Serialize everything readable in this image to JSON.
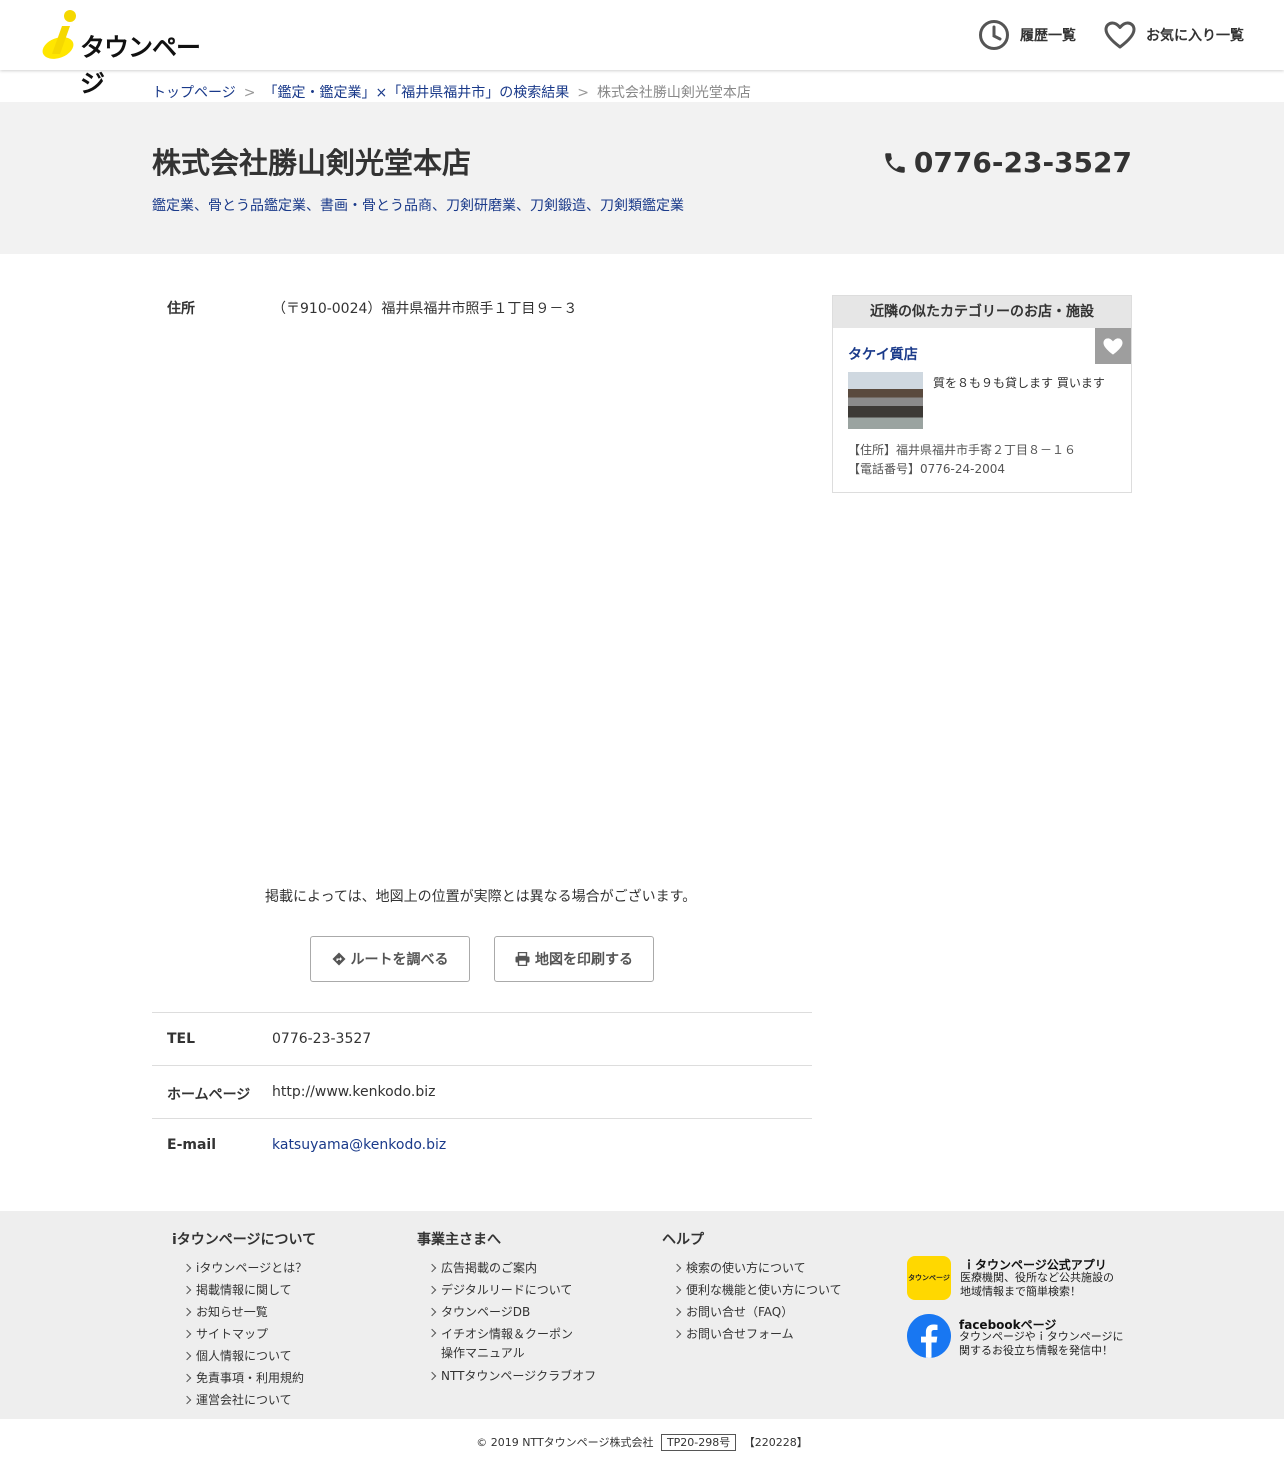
{
  "header": {
    "logo_text": "タウンページ",
    "history_label": "履歴一覧",
    "favorites_label": "お気に入り一覧"
  },
  "breadcrumb": {
    "top": "トップページ",
    "sep": ">",
    "search_result": "「鑑定・鑑定業」×「福井県福井市」の検索結果",
    "current": "株式会社勝山剣光堂本店"
  },
  "shop": {
    "name": "株式会社勝山剣光堂本店",
    "categories": "鑑定業、骨とう品鑑定業、書画・骨とう品商、刀剣研磨業、刀剣鍛造、刀剣類鑑定業",
    "phone": "0776-23-3527"
  },
  "info": {
    "address_label": "住所",
    "address_value": "（〒910-0024）福井県福井市照手１丁目９－３",
    "map_note": "掲載によっては、地図上の位置が実際とは異なる場合がございます。",
    "route_button": "ルートを調べる",
    "print_button": "地図を印刷する",
    "tel_label": "TEL",
    "tel_value": "0776-23-3527",
    "homepage_label": "ホームページ",
    "homepage_value": "http://www.kenkodo.biz",
    "email_label": "E-mail",
    "email_value": "katsuyama@kenkodo.biz"
  },
  "sidebar": {
    "heading": "近隣の似たカテゴリーのお店・施設",
    "item": {
      "name": "タケイ質店",
      "description": "質を８も９も貸します 買います",
      "address": "【住所】福井県福井市手寄２丁目８－１６",
      "tel": "【電話番号】0776-24-2004"
    }
  },
  "footer": {
    "col1": {
      "title": "iタウンページについて",
      "items": [
        "iタウンページとは？",
        "掲載情報に関して",
        "お知らせ一覧",
        "サイトマップ",
        "個人情報について",
        "免責事項・利用規約",
        "運営会社について"
      ]
    },
    "col2": {
      "title": "事業主さまへ",
      "items": [
        "広告掲載のご案内",
        "デジタルリードについて",
        "タウンページDB",
        "イチオシ情報＆クーポン",
        "操作マニュアル",
        "NTTタウンページクラブオフ"
      ]
    },
    "col3": {
      "title": "ヘルプ",
      "items": [
        "検索の使い方について",
        "便利な機能と使い方について",
        "お問い合せ（FAQ）",
        "お問い合せフォーム"
      ]
    },
    "app": {
      "icon_text": "タウンページ",
      "title": "ｉタウンページ公式アプリ",
      "desc_line1": "医療機関、役所など公共施設の",
      "desc_line2": "地域情報まで簡単検索！"
    },
    "facebook": {
      "title": "facebookページ",
      "desc_line1": "タウンページやｉタウンページに",
      "desc_line2": "関するお役立ち情報を発信中！"
    }
  },
  "copyright": {
    "text": "© 2019 NTTタウンページ株式会社",
    "code": "TP20-298号",
    "date": "【220228】"
  },
  "colors": {
    "link": "#1a3a8a",
    "band": "#f2f2f2",
    "footer_bg": "#eeeeee",
    "logo_yellow": "#ffe600"
  }
}
